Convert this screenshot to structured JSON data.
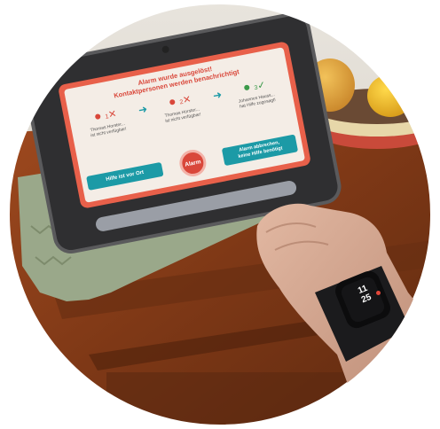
{
  "screen": {
    "title_line1": "Alarm wurde ausgelöst!",
    "title_line2": "Kontaktpersonen werden benachrichtigt",
    "steps": [
      {
        "badge": "1",
        "name": "Thomas Horster...",
        "status": "ist nicht verfügbar!"
      },
      {
        "badge": "2",
        "name": "Thomas Horster...",
        "status": "ist nicht verfügbar!"
      },
      {
        "badge": "3",
        "name": "Johannes Hauss...",
        "status": "hat Hilfe zugesagt!"
      }
    ],
    "buttons": {
      "help_on_site": "Hilfe ist vor Ort",
      "alarm": "Alarm",
      "cancel_line1": "Alarm abbrechen,",
      "cancel_line2": "keine Hilfe benötigt"
    }
  },
  "watch": {
    "time_hours": "11",
    "time_minutes": "25"
  },
  "colors": {
    "frame_red": "#e8604a",
    "screen_bg": "#f4ede6",
    "accent_red": "#d9473a",
    "teal": "#1c9aa6",
    "check_green": "#3b9a4a",
    "wood": "#8a3f1c"
  }
}
